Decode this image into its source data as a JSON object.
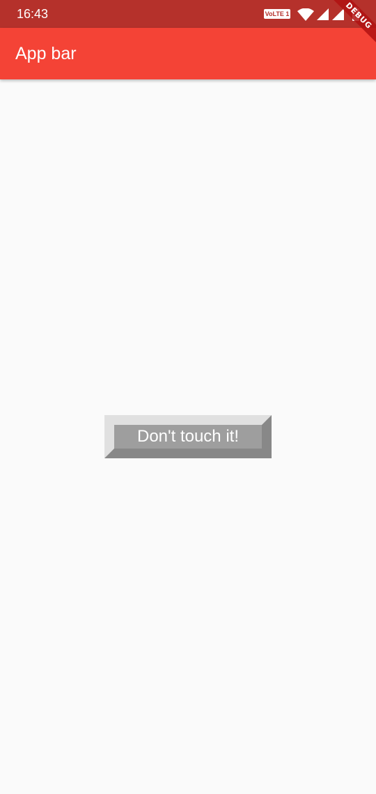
{
  "status_bar": {
    "time": "16:43",
    "volte_label": "VoLTE 1",
    "icons": [
      "wifi-icon",
      "cell-signal-icon",
      "cell-signal-icon",
      "battery-charging-icon"
    ],
    "background_color": "#b5312b"
  },
  "debug_banner": {
    "label": "DEBUG"
  },
  "app_bar": {
    "title": "App bar",
    "background_color": "#f44336"
  },
  "main": {
    "button_label": "Don't touch it!",
    "button_colors": {
      "face": "#9e9e9e",
      "highlight": "#e0e0e0",
      "shadow": "#888888"
    }
  }
}
